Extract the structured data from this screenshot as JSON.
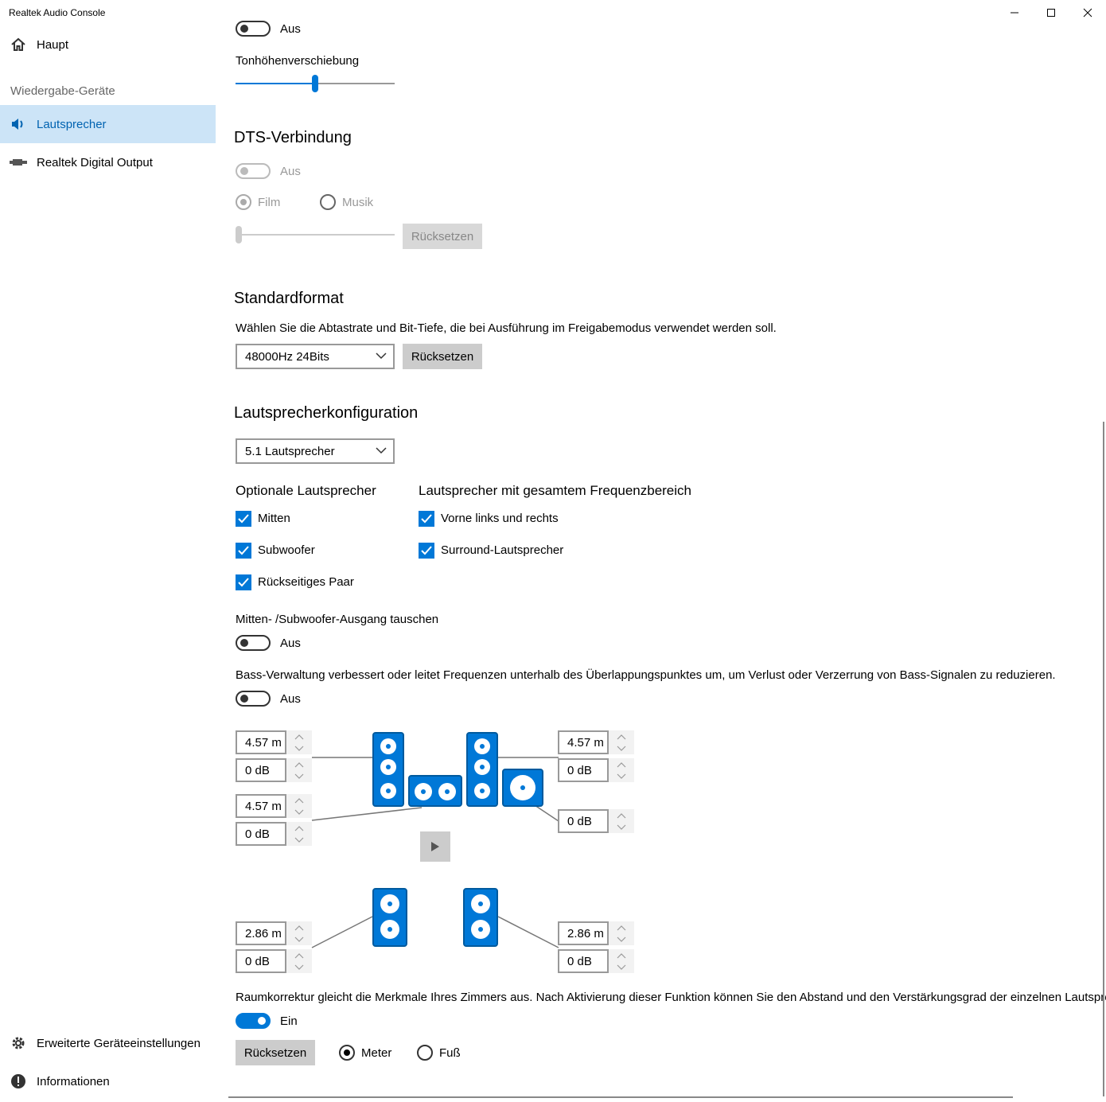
{
  "window": {
    "title": "Realtek Audio Console"
  },
  "sidebar": {
    "home": "Haupt",
    "group_title": "Wiedergabe-Geräte",
    "devices": [
      {
        "label": "Lautsprecher",
        "selected": true,
        "icon": "speaker-icon"
      },
      {
        "label": "Realtek Digital Output",
        "selected": false,
        "icon": "digital-output-icon"
      }
    ],
    "advanced": "Erweiterte Geräteeinstellungen",
    "info": "Informationen"
  },
  "top": {
    "toggle_label": "Aus",
    "pitch_label": "Tonhöhenverschiebung",
    "pitch_value": 0.5
  },
  "dts": {
    "title": "DTS-Verbindung",
    "toggle_label": "Aus",
    "radio_film": "Film",
    "radio_music": "Musik",
    "reset": "Rücksetzen"
  },
  "format": {
    "title": "Standardformat",
    "description": "Wählen Sie die Abtastrate und Bit-Tiefe, die bei Ausführung im Freigabemodus verwendet werden soll.",
    "selected": "48000Hz 24Bits",
    "reset": "Rücksetzen"
  },
  "config": {
    "title": "Lautsprecherkonfiguration",
    "selected": "5.1 Lautsprecher",
    "optional_title": "Optionale Lautsprecher",
    "optional": [
      "Mitten",
      "Subwoofer",
      "Rückseitiges Paar"
    ],
    "fullrange_title": "Lautsprecher mit gesamtem Frequenzbereich",
    "fullrange": [
      "Vorne links und rechts",
      "Surround-Lautsprecher"
    ],
    "swap_label": "Mitten- /Subwoofer-Ausgang tauschen",
    "swap_toggle": "Aus",
    "bass_desc": "Bass-Verwaltung verbessert oder leitet Frequenzen unterhalb des Überlappungspunktes um, um Verlust oder Verzerrung von Bass-Signalen zu reduzieren.",
    "bass_toggle": "Aus"
  },
  "room": {
    "front_left_dist": "4.57 m",
    "front_left_gain": "0 dB",
    "center_dist": "4.57 m",
    "center_gain": "0 dB",
    "front_right_dist": "4.57 m",
    "front_right_gain": "0 dB",
    "sub_gain": "0 dB",
    "rear_left_dist": "2.86 m",
    "rear_left_gain": "0 dB",
    "rear_right_dist": "2.86 m",
    "rear_right_gain": "0 dB",
    "correction_desc": "Raumkorrektur gleicht die Merkmale Ihres Zimmers aus. Nach Aktivierung dieser Funktion können Sie den Abstand und den Verstärkungsgrad der einzelnen Lautsprec",
    "correction_toggle": "Ein",
    "reset": "Rücksetzen",
    "unit_meter": "Meter",
    "unit_foot": "Fuß"
  }
}
